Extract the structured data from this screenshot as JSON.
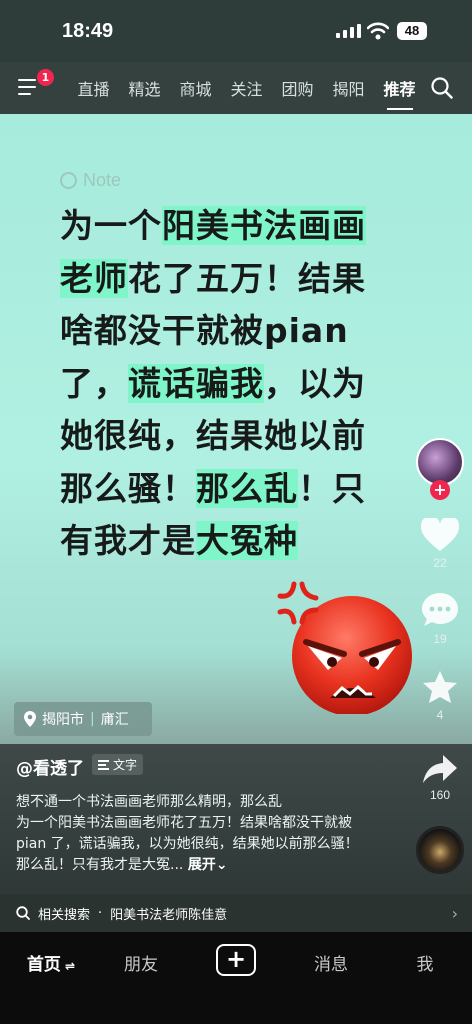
{
  "status_bar": {
    "time": "18:49",
    "battery": "48"
  },
  "top_nav": {
    "notification_count": "1",
    "tabs": [
      {
        "label": "直播"
      },
      {
        "label": "精选"
      },
      {
        "label": "商城"
      },
      {
        "label": "关注"
      },
      {
        "label": "团购"
      },
      {
        "label": "揭阳"
      },
      {
        "label": "推荐"
      }
    ],
    "active_tab": "推荐"
  },
  "video": {
    "note_label": "Note",
    "text_lines": [
      [
        {
          "t": "为一个"
        },
        {
          "t": "阳美书法画画",
          "hl": true
        }
      ],
      [
        {
          "t": "老师",
          "hl": true
        },
        {
          "t": "花了五万！结果"
        }
      ],
      [
        {
          "t": "啥都没干就被pian"
        }
      ],
      [
        {
          "t": "了，"
        },
        {
          "t": "谎话骗我",
          "hl": true
        },
        {
          "t": "，以为"
        }
      ],
      [
        {
          "t": "她很纯，结果她以前"
        }
      ],
      [
        {
          "t": "那么骚！"
        },
        {
          "t": "那么乱",
          "hl": true
        },
        {
          "t": "！只"
        }
      ],
      [
        {
          "t": "有我才是"
        },
        {
          "t": "大冤种",
          "hl": true
        }
      ]
    ],
    "location": {
      "city": "揭阳市",
      "district": "庯汇"
    }
  },
  "side_actions": {
    "likes": "22",
    "comments": "19",
    "favorites": "4",
    "shares": "160"
  },
  "info": {
    "author": "@看透了",
    "tag_label": "文字",
    "description": "想不通一个书法画画老师那么精明，那么乱\n为一个阳美书法画画老师花了五万！结果啥都没干就被 pian 了，谎话骗我，以为她很纯，结果她以前那么骚！那么乱！只有我才是大冤...",
    "expand_label": "展开"
  },
  "related_search": {
    "prefix": "相关搜索",
    "query": "阳美书法老师陈佳意"
  },
  "bottom_nav": {
    "home": "首页",
    "friends": "朋友",
    "messages": "消息",
    "me": "我"
  },
  "colors": {
    "highlight": "#7ff5c9",
    "accent": "#f0264f",
    "background": "#b0f0e2"
  }
}
